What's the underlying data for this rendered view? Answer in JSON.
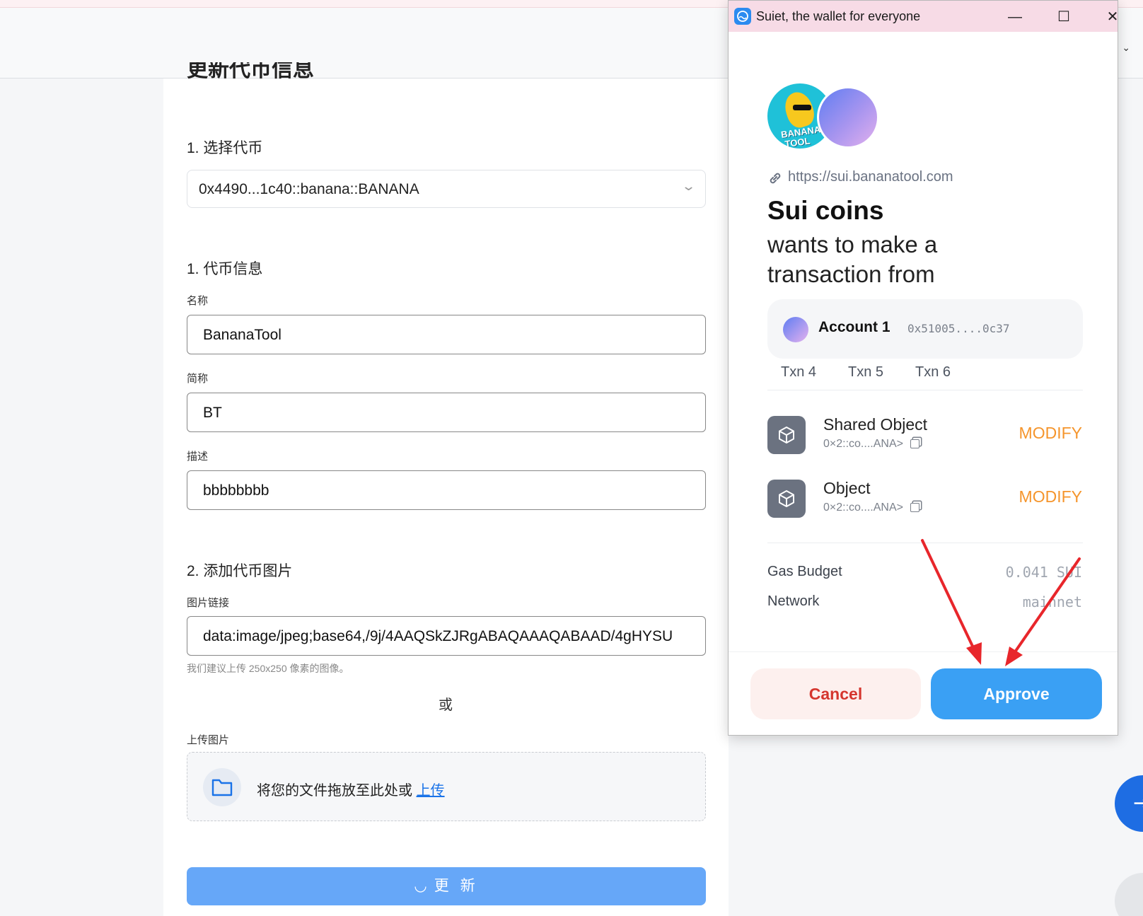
{
  "page": {
    "section_title_cut": "更新代币信息",
    "section1_title": "1. 选择代币",
    "token_select_value": "0x4490...1c40::banana::BANANA",
    "section2_title": "1. 代币信息",
    "name_label": "名称",
    "name_value": "BananaTool",
    "symbol_label": "简称",
    "symbol_value": "BT",
    "desc_label": "描述",
    "desc_value": "bbbbbbbb",
    "section3_title": "2. 添加代币图片",
    "image_link_label": "图片链接",
    "image_link_value": "data:image/jpeg;base64,/9j/4AAQSkZJRgABAQAAAQABAAD/4gHYSU",
    "image_hint": "我们建议上传 250x250 像素的图像。",
    "or_text": "或",
    "upload_label": "上传图片",
    "drop_text": "将您的文件拖放至此处或 ",
    "drop_link": "上传",
    "update_button": "更 新"
  },
  "wallet": {
    "window_title": "Suiet, the wallet for everyone",
    "logo_text": "BANANA TOOL",
    "site_url": "https://sui.bananatool.com",
    "title": "Sui coins",
    "subtitle": "wants to make a transaction from",
    "account_name": "Account 1",
    "account_addr": "0x51005....0c37",
    "tabs": [
      "Txn 4",
      "Txn 5",
      "Txn 6"
    ],
    "objects": [
      {
        "name": "Shared Object",
        "type": "0×2::co....ANA>",
        "action": "MODIFY"
      },
      {
        "name": "Object",
        "type": "0×2::co....ANA>",
        "action": "MODIFY"
      }
    ],
    "gas_label": "Gas Budget",
    "gas_value": "0.041 SUI",
    "network_label": "Network",
    "network_value": "mainnet",
    "cancel_button": "Cancel",
    "approve_button": "Approve"
  },
  "colors": {
    "accent_blue": "#3aa0f4",
    "modify_orange": "#f5952c",
    "cancel_red": "#d5362e",
    "annotation_arrow": "#e8262b"
  },
  "icons": [
    "link-icon",
    "cube-icon",
    "copy-icon",
    "folder-icon",
    "minimize-icon",
    "maximize-icon",
    "close-icon",
    "chevron-down-icon",
    "exchange-icon"
  ]
}
